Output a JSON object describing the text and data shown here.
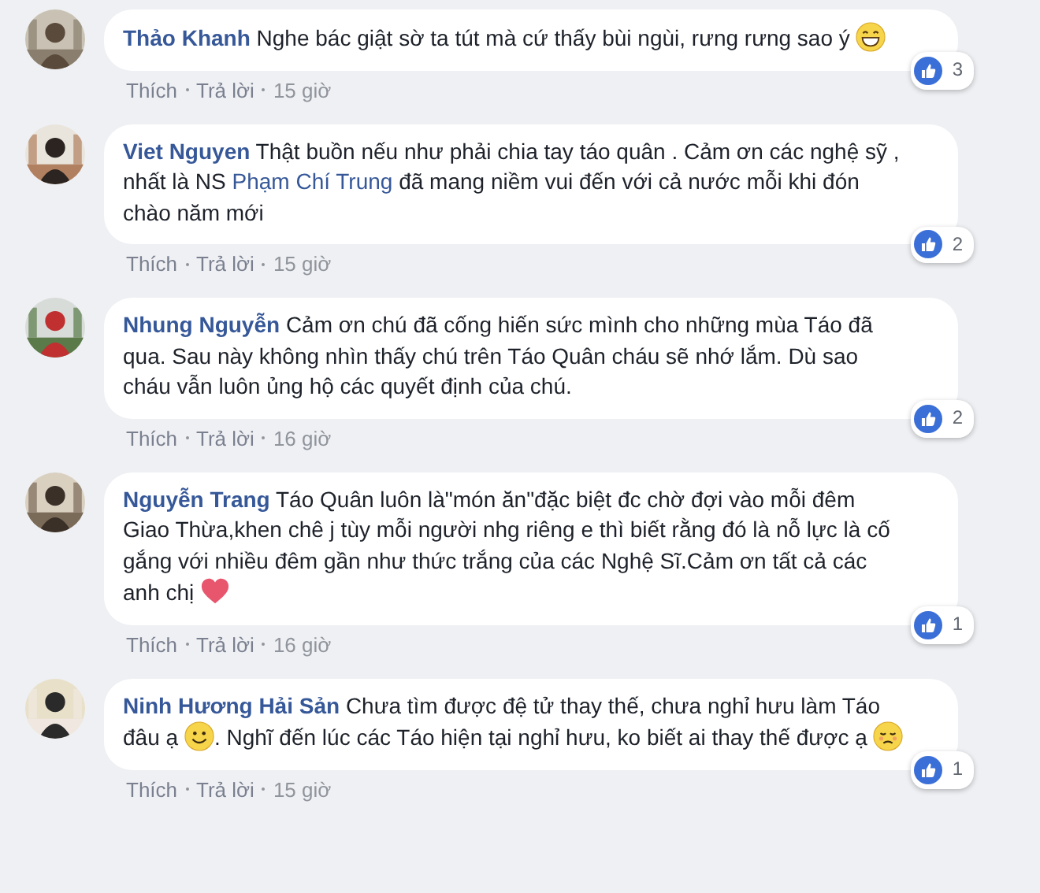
{
  "comments": [
    {
      "author": "Thảo Khanh",
      "body": [
        {
          "kind": "text",
          "text": "Nghe bác giật sờ ta tút mà cứ thấy bùi ngùi, rưng rưng sao ý "
        },
        {
          "kind": "grin"
        }
      ],
      "actions": [
        "Thích",
        "Trả lời"
      ],
      "time": "15 giờ",
      "likes": "3"
    },
    {
      "author": "Viet Nguyen",
      "body": [
        {
          "kind": "text",
          "text": "Thật buồn nếu như phải chia tay táo quân . Cảm ơn các nghệ sỹ , nhất là NS "
        },
        {
          "kind": "link",
          "text": "Phạm Chí Trung"
        },
        {
          "kind": "text",
          "text": " đã mang niềm vui đến với cả nước mỗi khi đón chào năm mới"
        }
      ],
      "actions": [
        "Thích",
        "Trả lời"
      ],
      "time": "15 giờ",
      "likes": "2"
    },
    {
      "author": "Nhung Nguyễn",
      "body": [
        {
          "kind": "text",
          "text": "Cảm ơn chú đã cống hiến sức mình cho những mùa Táo đã qua. Sau này không nhìn thấy chú trên Táo Quân cháu sẽ nhớ lắm. Dù sao cháu vẫn luôn ủng hộ các quyết định của chú."
        }
      ],
      "actions": [
        "Thích",
        "Trả lời"
      ],
      "time": "16 giờ",
      "likes": "2"
    },
    {
      "author": "Nguyễn Trang",
      "body": [
        {
          "kind": "text",
          "text": "Táo Quân luôn là\"món ăn\"đặc biệt đc chờ đợi vào mỗi đêm Giao Thừa,khen chê j tùy mỗi người nhg riêng e thì biết rằng đó là nỗ lực là cố gắng với nhiều đêm gần như thức trắng của các Nghệ Sĩ.Cảm ơn tất cả các anh chị "
        },
        {
          "kind": "heart"
        }
      ],
      "actions": [
        "Thích",
        "Trả lời"
      ],
      "time": "16 giờ",
      "likes": "1"
    },
    {
      "author": "Ninh Hương Hải Sản",
      "body": [
        {
          "kind": "text",
          "text": "Chưa tìm được đệ tử thay thế, chưa nghỉ hưu làm Táo đâu ạ "
        },
        {
          "kind": "smile"
        },
        {
          "kind": "text",
          "text": ". Nghĩ đến lúc các Táo hiện tại nghỉ hưu, ko biết ai thay thế được ạ "
        },
        {
          "kind": "worried"
        }
      ],
      "actions": [
        "Thích",
        "Trả lời"
      ],
      "time": "15 giờ",
      "likes": "1"
    }
  ]
}
